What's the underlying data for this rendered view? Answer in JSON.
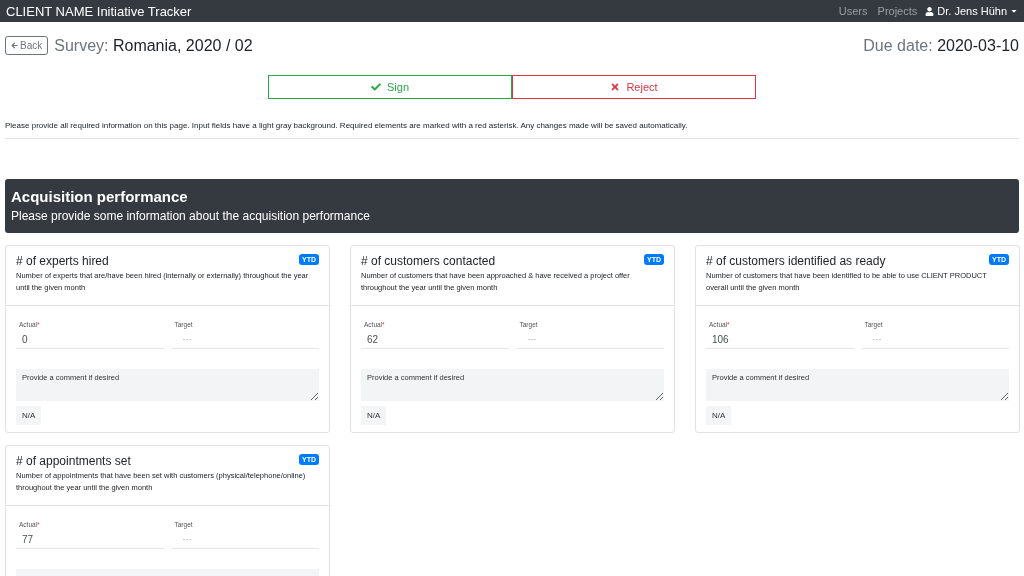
{
  "navbar": {
    "brand": "CLIENT NAME Initiative Tracker",
    "links": [
      "Users",
      "Projects"
    ],
    "user": "Dr. Jens Hühn"
  },
  "header": {
    "back": "Back",
    "title_prefix": "Survey:",
    "title": "Romania, 2020 / 02",
    "due_label": "Due date:",
    "due": "2020-03-10"
  },
  "actions": [
    {
      "kind": "sign",
      "label": "Sign"
    },
    {
      "kind": "reject",
      "label": "Reject"
    }
  ],
  "note": "Please provide all required information on this page. Input fields have a light gray background. Required elements are marked with a red asterisk. Any changes made will be saved automatically.",
  "section": {
    "title": "Acquisition performance",
    "subtitle": "Please provide some information about the acquisition performance"
  },
  "cards": [
    {
      "title": "# of experts hired",
      "badge": "YTD",
      "description": "Number of experts that are/have been hired (internally or externally) throughout the year until the given month",
      "actual_label": "Actual",
      "required_mark": "*",
      "actual": "0",
      "target_label": "Target",
      "target": "---",
      "comment_placeholder": "Provide a comment if desired",
      "na": "N/A"
    },
    {
      "title": "# of customers contacted",
      "badge": "YTD",
      "description": "Number of customers that have been approached & have received a project offer throughout the year until the given month",
      "actual_label": "Actual",
      "required_mark": "*",
      "actual": "62",
      "target_label": "Target",
      "target": "---",
      "comment_placeholder": "Provide a comment if desired",
      "na": "N/A"
    },
    {
      "title": "# of customers identified as ready",
      "badge": "YTD",
      "description": "Number of customers that have been identified to be able to use CLIENT PRODUCT overall until the given month",
      "actual_label": "Actual",
      "required_mark": "*",
      "actual": "106",
      "target_label": "Target",
      "target": "---",
      "comment_placeholder": "Provide a comment if desired",
      "na": "N/A"
    },
    {
      "title": "# of appointments set",
      "badge": "YTD",
      "description": "Number of appointments that have been set with customers (physical/telephone/online) throughout the year until the given month",
      "actual_label": "Actual",
      "required_mark": "*",
      "actual": "77",
      "target_label": "Target",
      "target": "---"
    }
  ]
}
